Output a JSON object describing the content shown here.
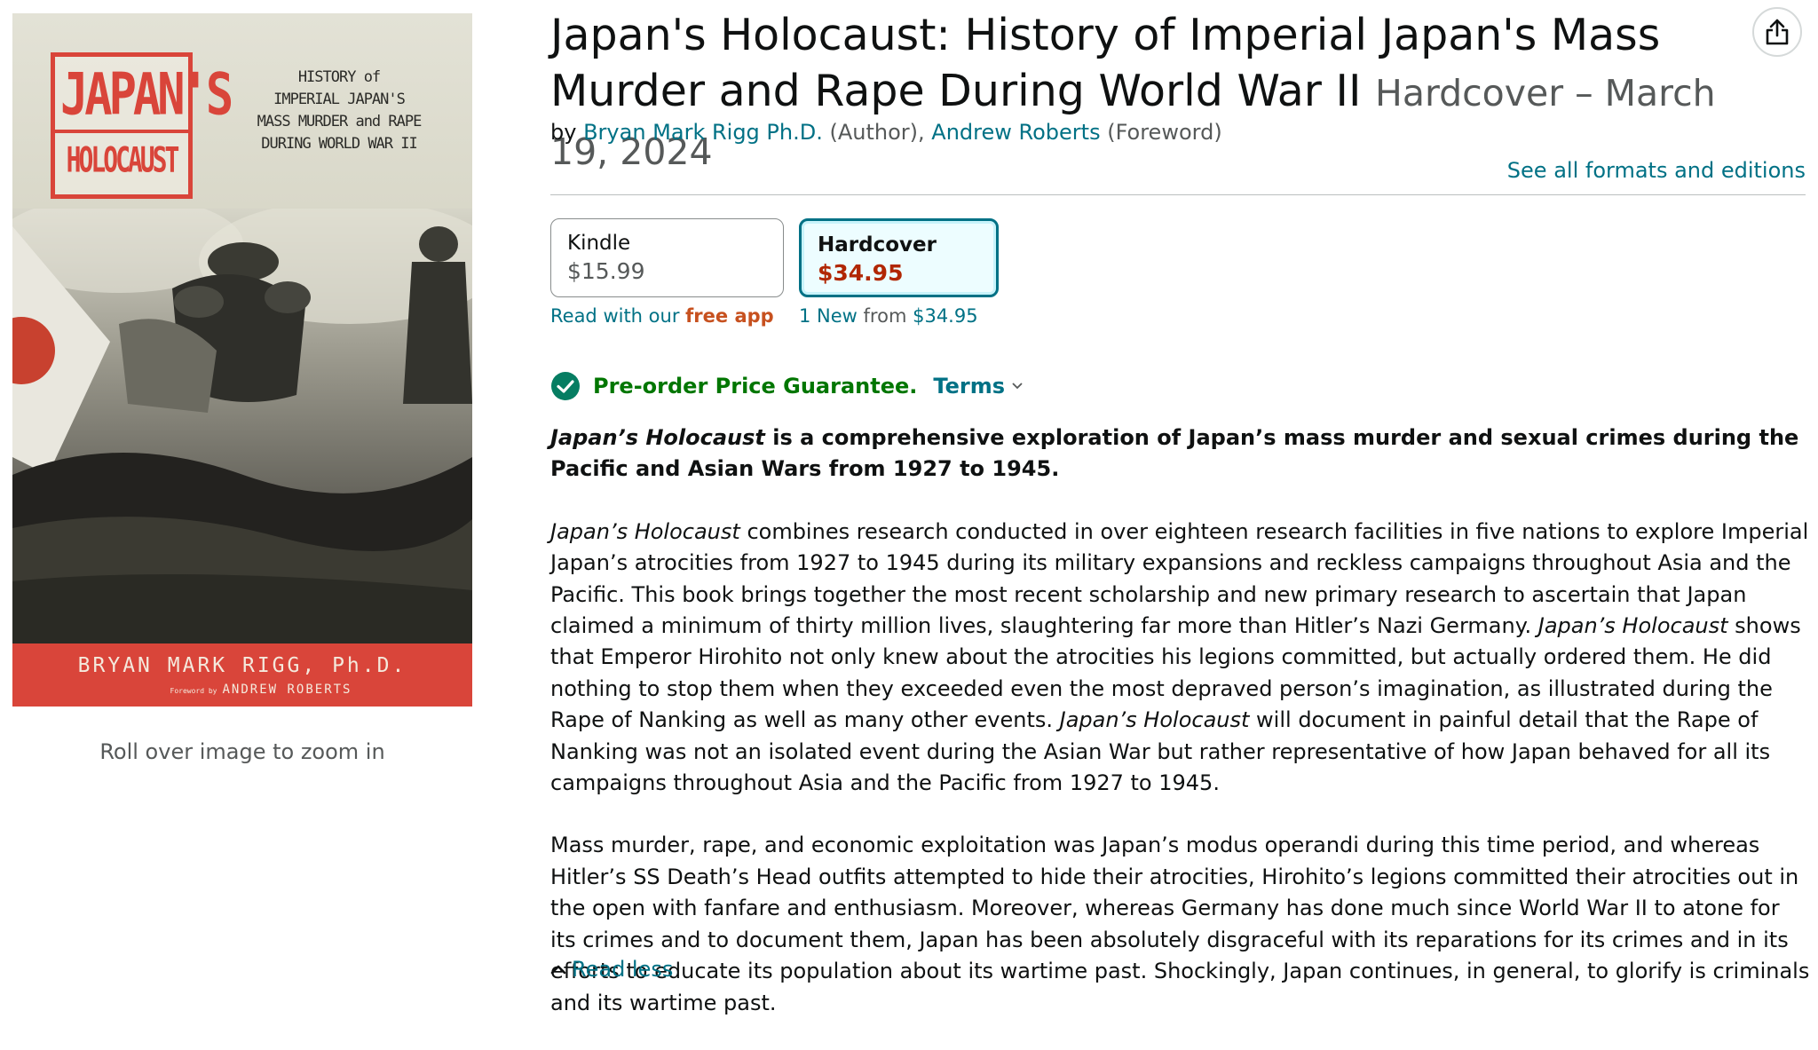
{
  "cover": {
    "title_line1": "JAPAN'S",
    "title_line2": "HOLOCAUST",
    "subtitle_lines": [
      "HISTORY of",
      "IMPERIAL JAPAN'S",
      "MASS MURDER and RAPE",
      "DURING WORLD WAR II"
    ],
    "author": "BRYAN MARK RIGG, Ph.D.",
    "foreword_prefix": "Foreword by",
    "foreword_name": "ANDREW ROBERTS",
    "accent_color": "#d9453a"
  },
  "image_hint": "Roll over image to zoom in",
  "product": {
    "title": "Japan's Holocaust: History of Imperial Japan's Mass Murder and Rape During World War II",
    "format_date": "Hardcover – March 19, 2024",
    "by": "by",
    "author1": "Bryan Mark Rigg Ph.D.",
    "author1_role": "(Author),",
    "author2": "Andrew Roberts",
    "author2_role": "(Foreword)",
    "see_all": "See all formats and editions"
  },
  "formats": {
    "kindle": {
      "name": "Kindle",
      "price": "$15.99",
      "sub_prefix": "Read with our",
      "sub_bold": "free app"
    },
    "hardcover": {
      "name": "Hardcover",
      "price": "$34.95",
      "sub_new": "1 New",
      "sub_from": "from",
      "sub_price": "$34.95"
    }
  },
  "guarantee": {
    "label": "Pre-order Price Guarantee.",
    "terms": "Terms",
    "check_icon": "check-circle-icon",
    "color": "#007600"
  },
  "description": {
    "lead_italic": "Japan’s Holocaust",
    "lead_rest": " is a comprehensive exploration of Japan’s mass murder and sexual crimes during the Pacific and Asian Wars from 1927 to 1945.",
    "p2_i1": "Japan’s Holocaust",
    "p2_t1": " combines research conducted in over eighteen research facilities in five nations to explore Imperial Japan’s atrocities from 1927 to 1945 during its military expansions and reckless campaigns throughout Asia and the Pacific. This book brings together the most recent scholarship and new primary research to ascertain that Japan claimed a minimum of thirty million lives, slaughtering far more than Hitler’s Nazi Germany. ",
    "p2_i2": "Japan’s Holocaust",
    "p2_t2": " shows that Emperor Hirohito not only knew about the atrocities his legions committed, but actually ordered them. He did nothing to stop them when they exceeded even the most depraved person’s imagination, as illustrated during the Rape of Nanking as well as many other events. ",
    "p2_i3": "Japan’s Holocaust",
    "p2_t3": " will document in painful detail that the Rape of Nanking was not an isolated event during the Asian War but rather representative of how Japan behaved for all its campaigns throughout Asia and the Pacific from 1927 to 1945.",
    "p3": "Mass murder, rape, and economic exploitation was Japan’s modus operandi during this time period, and whereas Hitler’s SS Death’s Head outfits attempted to hide their atrocities, Hirohito’s legions committed their atrocities out in the open with fanfare and enthusiasm. Moreover, whereas Germany has done much since World War II to atone for its crimes and to document them, Japan has been absolutely disgraceful with its reparations for its crimes and in its efforts to educate its population about its wartime past. Shockingly, Japan continues, in general, to glorify is criminals and its wartime past."
  },
  "read_less": "Read less",
  "colors": {
    "link": "#007185",
    "price_red": "#b12704",
    "muted": "#565959"
  }
}
